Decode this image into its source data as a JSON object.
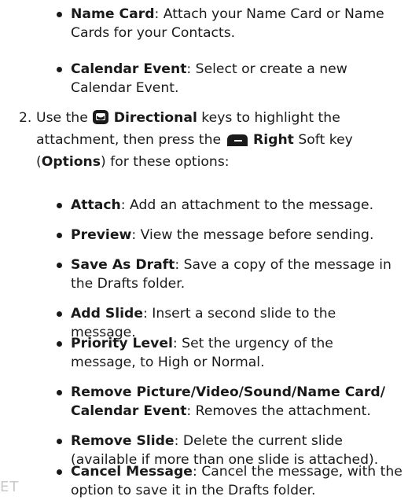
{
  "intro_bullets": [
    {
      "term": "Name Card",
      "text": ": Attach your Name Card or Name Cards for your Contacts."
    },
    {
      "term": "Calendar Event",
      "text": ": Select or create a new Calendar Event."
    }
  ],
  "step": {
    "number": "2.",
    "text_1": "Use the ",
    "directional_label": "Directional",
    "text_2": " keys to highlight the attachment, then press the ",
    "right_label": "Right",
    "text_3": " Soft key (",
    "options_label": "Options",
    "text_4": ") for these options:"
  },
  "options": [
    {
      "term": "Attach",
      "text": ": Add an attachment to the message."
    },
    {
      "term": "Preview",
      "text": ": View the message before sending."
    },
    {
      "term": "Save As Draft",
      "text": ": Save a copy of the message in the Drafts folder."
    },
    {
      "term": "Add Slide",
      "text": ": Insert a second slide to the message."
    },
    {
      "term": "Priority Level",
      "text": ": Set the urgency of the message, to High or Normal."
    },
    {
      "term": "Remove Picture/Video/Sound/Name Card/ Calendar Event",
      "text": ": Removes the attachment."
    },
    {
      "term": "Remove Slide",
      "text": ": Delete the current slide (available if more than one slide is attached)."
    },
    {
      "term": "Cancel Message",
      "text": ": Cancel the message, with the option to save it in the Drafts folder."
    }
  ],
  "corner_mark": "ET",
  "icons": [
    "directional-key-icon",
    "right-soft-key-icon"
  ]
}
